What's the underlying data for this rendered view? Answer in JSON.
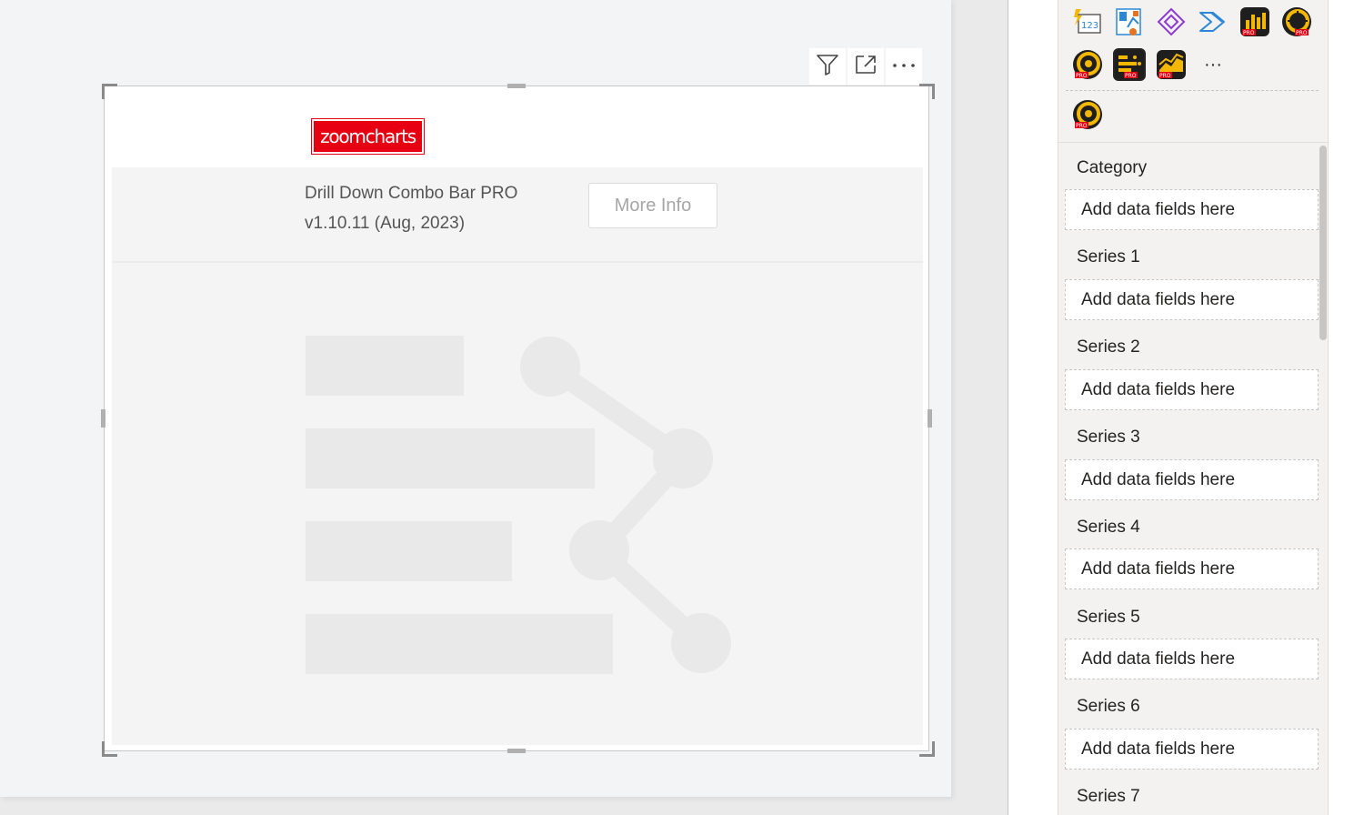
{
  "visual_header": {
    "filter_icon": "filter-icon",
    "focus_icon": "focus-mode-icon",
    "more_icon": "more-options-icon"
  },
  "visual": {
    "logo_text": "zoomcharts",
    "product_name": "Drill Down Combo Bar PRO",
    "version": "v1.10.11 (Aug, 2023)",
    "more_info_label": "More Info"
  },
  "visualizations": {
    "more_label": "···",
    "icons": [
      "number-card-icon",
      "custom-visual-icon",
      "power-apps-icon",
      "power-automate-icon",
      "zoomcharts-pro-icon",
      "zoomcharts-pro-icon",
      "zoomcharts-pro-icon",
      "zoomcharts-combo-bar-pro-icon",
      "zoomcharts-pro-icon",
      "zoomcharts-pro-icon"
    ],
    "pro_badge": "PRO"
  },
  "field_wells": [
    {
      "label": "Category",
      "placeholder": "Add data fields here"
    },
    {
      "label": "Series 1",
      "placeholder": "Add data fields here"
    },
    {
      "label": "Series 2",
      "placeholder": "Add data fields here"
    },
    {
      "label": "Series 3",
      "placeholder": "Add data fields here"
    },
    {
      "label": "Series 4",
      "placeholder": "Add data fields here"
    },
    {
      "label": "Series 5",
      "placeholder": "Add data fields here"
    },
    {
      "label": "Series 6",
      "placeholder": "Add data fields here"
    },
    {
      "label": "Series 7",
      "placeholder": ""
    }
  ],
  "colors": {
    "brand_red": "#e60012",
    "pro_dark": "#1e1e1e",
    "pro_gold": "#f5b800",
    "accent_blue": "#2b88d8"
  }
}
